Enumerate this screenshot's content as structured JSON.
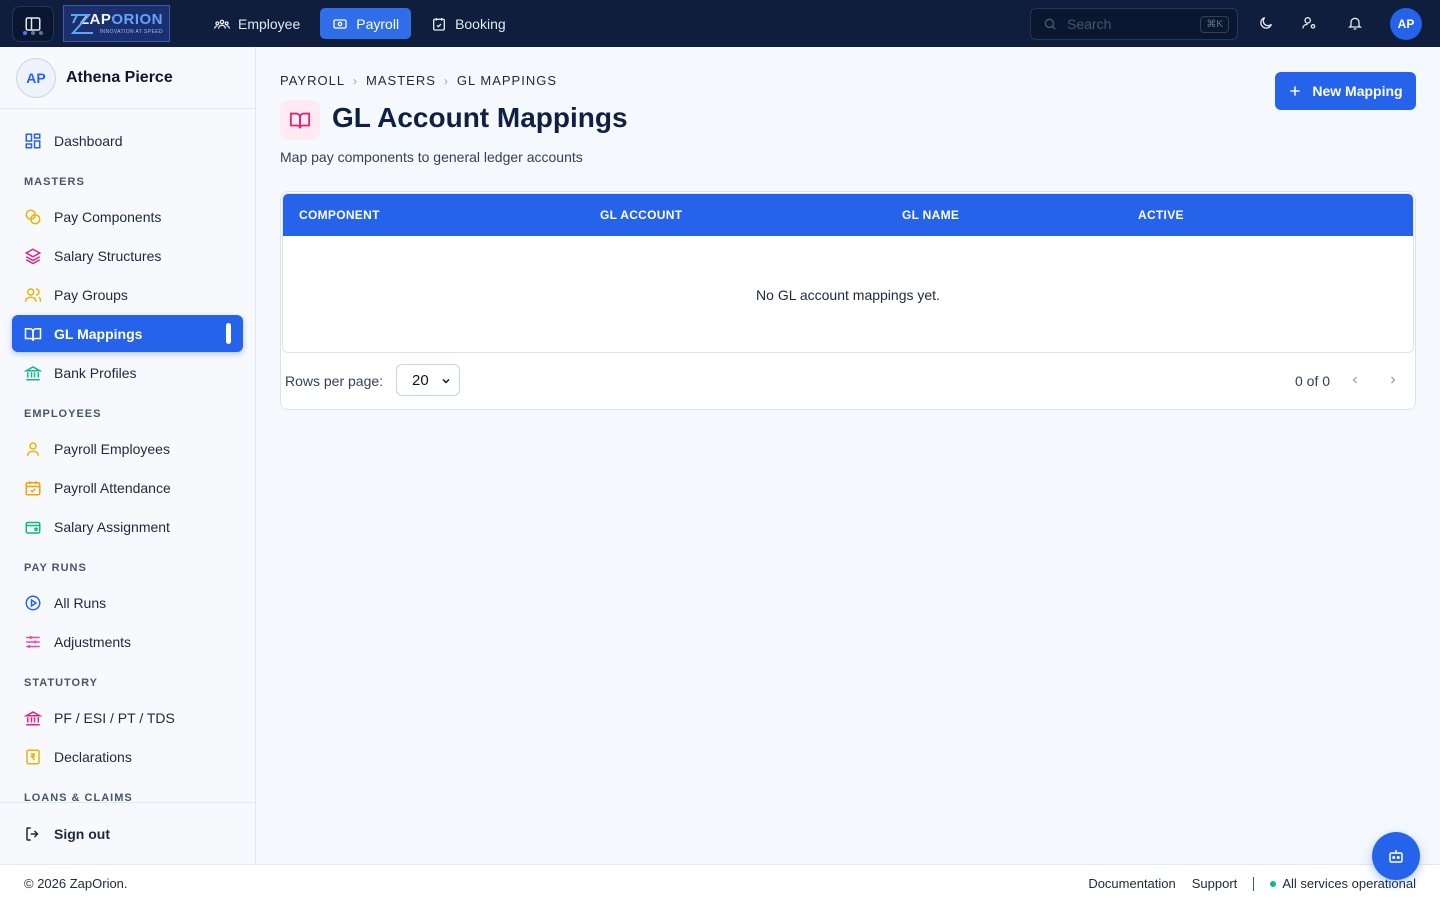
{
  "app": {
    "logo": {
      "brand_a": "ZAP",
      "brand_b": "ORION",
      "tagline": "INNOVATION AT SPEED"
    },
    "top_nav": [
      {
        "label": "Employee",
        "icon": "users-icon",
        "active": false
      },
      {
        "label": "Payroll",
        "icon": "wallet-icon",
        "active": true
      },
      {
        "label": "Booking",
        "icon": "calendar-check-icon",
        "active": false
      }
    ],
    "search": {
      "placeholder": "Search",
      "shortcut": "⌘K"
    },
    "user_initials": "AP"
  },
  "sidebar": {
    "user": {
      "initials": "AP",
      "name": "Athena Pierce"
    },
    "dashboard": "Dashboard",
    "sections": {
      "masters": "MASTERS",
      "employees": "EMPLOYEES",
      "pay_runs": "PAY RUNS",
      "statutory": "STATUTORY",
      "loans": "LOANS & CLAIMS"
    },
    "items": {
      "pay_components": "Pay Components",
      "salary_structures": "Salary Structures",
      "pay_groups": "Pay Groups",
      "gl_mappings": "GL Mappings",
      "bank_profiles": "Bank Profiles",
      "payroll_employees": "Payroll Employees",
      "payroll_attendance": "Payroll Attendance",
      "salary_assignment": "Salary Assignment",
      "all_runs": "All Runs",
      "adjustments": "Adjustments",
      "statutory_items": "PF / ESI / PT / TDS",
      "declarations": "Declarations"
    },
    "sign_out": "Sign out"
  },
  "page": {
    "breadcrumb": [
      "PAYROLL",
      "MASTERS",
      "GL MAPPINGS"
    ],
    "title": "GL Account Mappings",
    "subtitle": "Map pay components to general ledger accounts",
    "new_button": "New Mapping",
    "table": {
      "columns": [
        "COMPONENT",
        "GL ACCOUNT",
        "GL NAME",
        "ACTIVE"
      ],
      "rows": [],
      "empty_message": "No GL account mappings yet."
    },
    "pagination": {
      "rows_label": "Rows per page:",
      "rows_value": "20",
      "count": "0 of 0"
    }
  },
  "footer": {
    "copyright": "© 2026 ZapOrion.",
    "documentation": "Documentation",
    "support": "Support",
    "status": "All services operational"
  },
  "colors": {
    "primary": "#2563eb",
    "topbar": "#0f1e3d",
    "status_ok": "#10b981",
    "accent_pink": "#db2777"
  }
}
